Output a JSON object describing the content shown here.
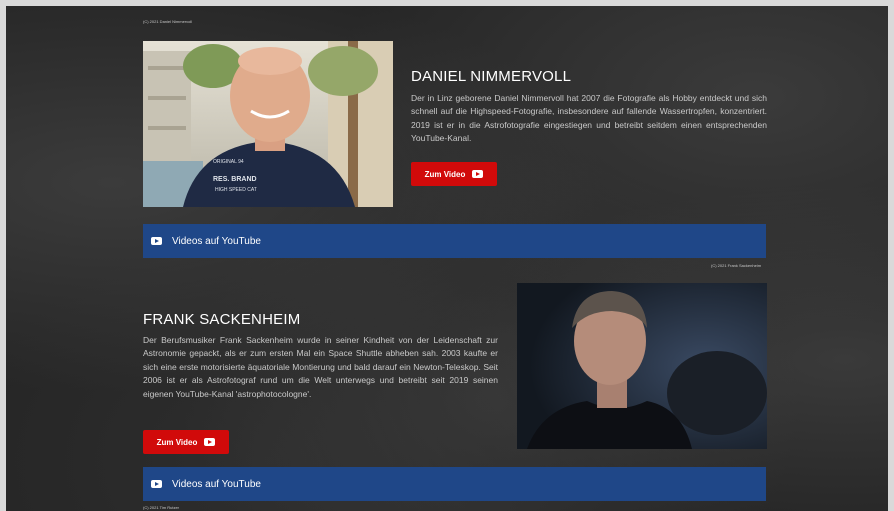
{
  "profiles": [
    {
      "credit": "(C) 2021 Daniel Nimmervoll",
      "name": "DANIEL NIMMERVOLL",
      "bio": "Der in Linz geborene Daniel Nimmervoll hat 2007 die Fotografie als Hobby entdeckt und sich schnell auf die Highspeed-Fotografie, insbesondere auf fallende Wassertropfen, konzentriert. 2019 ist er in die Astrofotografie eingestiegen und betreibt seitdem einen entsprechenden YouTube-Kanal.",
      "button_label": "Zum Video",
      "bar_label": "Videos auf YouTube",
      "shirt_lines": [
        "ORIGINAL 94",
        "RES. BRAND",
        "HIGH SPEED CAT"
      ]
    },
    {
      "credit": "(C) 2021 Frank Sackenheim",
      "name": "FRANK SACKENHEIM",
      "bio": "Der Berufsmusiker Frank Sackenheim wurde in seiner Kindheit von der Leidenschaft zur Astronomie gepackt, als er zum ersten Mal ein Space Shuttle abheben sah. 2003 kaufte er sich eine erste motorisierte äquatoriale Montierung und bald darauf ein Newton-Teleskop. Seit 2006 ist er als Astrofotograf rund um die Welt unterwegs und betreibt seit 2019 seinen eigenen YouTube-Kanal 'astrophotocologne'.",
      "button_label": "Zum Video",
      "bar_label": "Videos auf YouTube"
    }
  ],
  "bottom_credit": "(C) 2021 Tim Rutzer",
  "icons": {
    "button": "youtube-icon",
    "bar": "youtube-icon"
  },
  "colors": {
    "button_red": "#d10a0a",
    "bar_blue": "#1f4788",
    "background": "#262626"
  }
}
